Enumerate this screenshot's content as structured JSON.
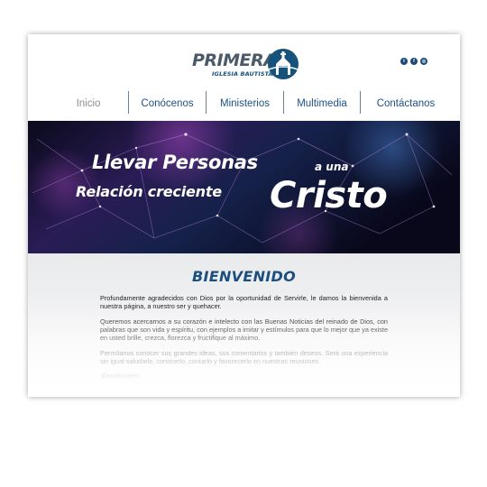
{
  "logo": {
    "word": "PRIMERA",
    "sub": "IGLESIA BAUTISTA"
  },
  "social": [
    "twitter-icon",
    "facebook-icon",
    "instagram-icon"
  ],
  "nav": [
    "Inicio",
    "Conócenos",
    "Ministerios",
    "Multimedia",
    "Contáctanos"
  ],
  "banner": {
    "line1": "Llevar Personas",
    "line1_small": "a una",
    "line2": "Relación creciente",
    "line2_big": "Cristo"
  },
  "content": {
    "heading": "BIENVENIDO",
    "p1": "Profundamente agradecidos con Dios por la oportunidad de Servirle, le damos la bienvenida a nuestra página, a nuestro ser y quehacer.",
    "p2": "Queremos acercarnos a su corazón e intelecto con las Buenas Noticias del reinado de Dios, con palabras que son vida y espíritu, con ejemplos a imitar y estímulos para que lo mejor que ya existe en usted brille, crezca, florezca y fructifique al máximo.",
    "p3": "Permítanos conocer sus grandes ideas, sus comentarios y también deseos. Será una experiencia sin igual saludarlo, conocerlo, contarlo y favorecerlo en nuestras reuniones.",
    "p4": "¡Bendiciones!"
  },
  "colors": {
    "brand_blue": "#1d5184",
    "logo_gray": "#4a5a6a",
    "banner_bg": "#0d0a26"
  }
}
